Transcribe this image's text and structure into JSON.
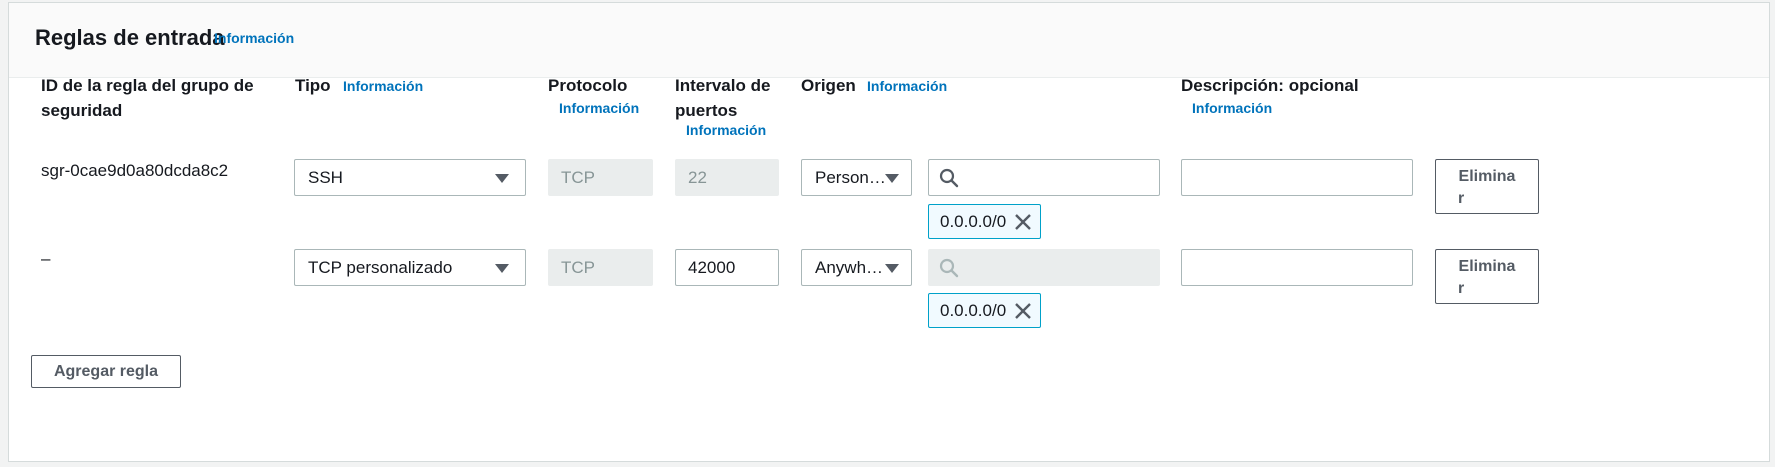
{
  "panel": {
    "title": "Reglas de entrada",
    "info": "Información"
  },
  "columns": {
    "rule_id": "ID de la regla del grupo de seguridad",
    "rule_id_line1": "ID de la regla del grupo de",
    "rule_id_line2": "seguridad",
    "type": "Tipo",
    "type_info": "Información",
    "protocol": "Protocolo",
    "protocol_info": "Información",
    "port_line1": "Intervalo de",
    "port_line2": "puertos",
    "port_info": "Información",
    "source": "Origen",
    "source_info": "Información",
    "description": "Descripción: opcional",
    "description_info": "Información"
  },
  "rules": [
    {
      "id": "sgr-0cae9d0a80dcda8c2",
      "type": "SSH",
      "protocol": "TCP",
      "port": "22",
      "source_type": "Person…",
      "source_search": "",
      "cidr": "0.0.0.0/0",
      "description": "",
      "delete_line1": "Elimina",
      "delete_line2": "r"
    },
    {
      "id": "–",
      "type": "TCP personalizado",
      "protocol": "TCP",
      "port": "42000",
      "source_type": "Anywh…",
      "source_search": "",
      "cidr": "0.0.0.0/0",
      "description": "",
      "delete_line1": "Elimina",
      "delete_line2": "r"
    }
  ],
  "add_rule_button": "Agregar regla",
  "icons": {
    "search": "search-icon",
    "caret": "caret-down-icon",
    "remove": "close-icon"
  },
  "colors": {
    "link": "#0073bb",
    "token_border": "#00a1c9",
    "token_bg": "#f1faff",
    "disabled_bg": "#eaeded"
  }
}
